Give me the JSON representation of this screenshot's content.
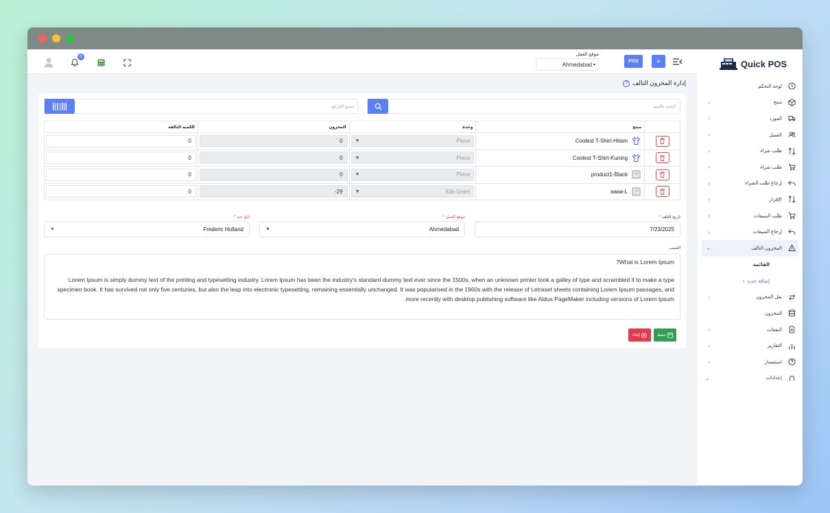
{
  "app": {
    "brand": "Quick",
    "brand_bold": "POS",
    "page_title": "إدارة المخزون التالف"
  },
  "topbar": {
    "notification_count": "0",
    "work_location_label": "موقع العمل",
    "work_location_value": "Ahmedabad",
    "pos_label": "POS",
    "add_label": "+"
  },
  "sidebar": {
    "items": [
      {
        "label": "لوحة التحكم",
        "icon": "dashboard-icon",
        "chevron": false
      },
      {
        "label": "منتج",
        "icon": "box-icon",
        "chevron": true
      },
      {
        "label": "المورد",
        "icon": "truck-icon",
        "chevron": true
      },
      {
        "label": "العميل",
        "icon": "users-icon",
        "chevron": true
      },
      {
        "label": "طلب شراء",
        "icon": "swap-icon",
        "chevron": true
      },
      {
        "label": "طلب شراء",
        "icon": "cart-icon",
        "chevron": true
      },
      {
        "label": "إرجاع طلب الشراء",
        "icon": "return-icon",
        "chevron": true
      },
      {
        "label": "الإقرار",
        "icon": "swap-icon",
        "chevron": true
      },
      {
        "label": "طلب المبيعات",
        "icon": "cart-icon",
        "chevron": true
      },
      {
        "label": "إرجاع المبيعات",
        "icon": "return-icon",
        "chevron": true
      },
      {
        "label": "المخزون التالف",
        "icon": "warning-icon",
        "chevron": true,
        "active": true
      }
    ],
    "sub_items": [
      {
        "label": "القائمة"
      },
      {
        "label": "إضافة جديد"
      }
    ],
    "items_after": [
      {
        "label": "نقل المخزون",
        "icon": "transfer-icon",
        "chevron": true
      },
      {
        "label": "المخزون",
        "icon": "database-icon",
        "chevron": false
      },
      {
        "label": "النفقات",
        "icon": "expense-icon",
        "chevron": true
      },
      {
        "label": "التقارير",
        "icon": "chart-icon",
        "chevron": true
      },
      {
        "label": "استفسار",
        "icon": "help-icon",
        "chevron": true
      },
      {
        "label": "إعدادات",
        "icon": "headset-icon",
        "chevron": true
      }
    ]
  },
  "search": {
    "name_placeholder": "البحث بالاسم",
    "barcode_placeholder": "مسح الباركود"
  },
  "table": {
    "headers": {
      "product": "منتج",
      "unit": "وحدة",
      "stock": "المخزون",
      "damaged_qty": "الكمية التالفة"
    },
    "rows": [
      {
        "product": "Coolest T-Shirt-Hitam",
        "image": "tshirt-icon",
        "unit": "Piece",
        "stock": "0",
        "damaged_qty": "0"
      },
      {
        "product": "Coolest T-Shirt-Kuning",
        "image": "tshirt-icon",
        "unit": "Piece",
        "stock": "0",
        "damaged_qty": "0"
      },
      {
        "product": "product1-Black",
        "image": "placeholder-image-icon",
        "unit": "Piece",
        "stock": "0",
        "damaged_qty": "0"
      },
      {
        "product": "aaaa-L",
        "image": "placeholder-image-icon",
        "unit": "Kilo Gram",
        "stock": "-29",
        "damaged_qty": "0"
      }
    ]
  },
  "form": {
    "damage_date_label": "تاريخ التلف",
    "damage_date_value": "7/23/2025",
    "location_label": "موقع العمل",
    "location_value": "Ahmedabad",
    "reported_by_label": "أبلغ عنه",
    "reported_by_value": "Frederic Holland",
    "required_mark": "*",
    "reason_label": "السبب",
    "reason_line1": "What is Lorem Ipsum?",
    "reason_line2": "Lorem Ipsum is simply dummy text of the printing and typesetting industry. Lorem Ipsum has been the industry's standard dummy text ever since the 1500s, when an unknown printer took a galley of type and scrambled it to make a type specimen book. It has survived not only five centuries, but also the leap into electronic typesetting, remaining essentially unchanged. It was popularised in the 1960s with the release of Letraset sheets containing Lorem Ipsum passages, and more recently with desktop publishing software like Aldus PageMaker including versions of Lorem Ipsum."
  },
  "actions": {
    "save_label": "حفظ",
    "cancel_label": "إلغاء"
  },
  "colors": {
    "accent": "#5b7ff4",
    "danger": "#e34b4b",
    "success": "#2f9e54"
  }
}
